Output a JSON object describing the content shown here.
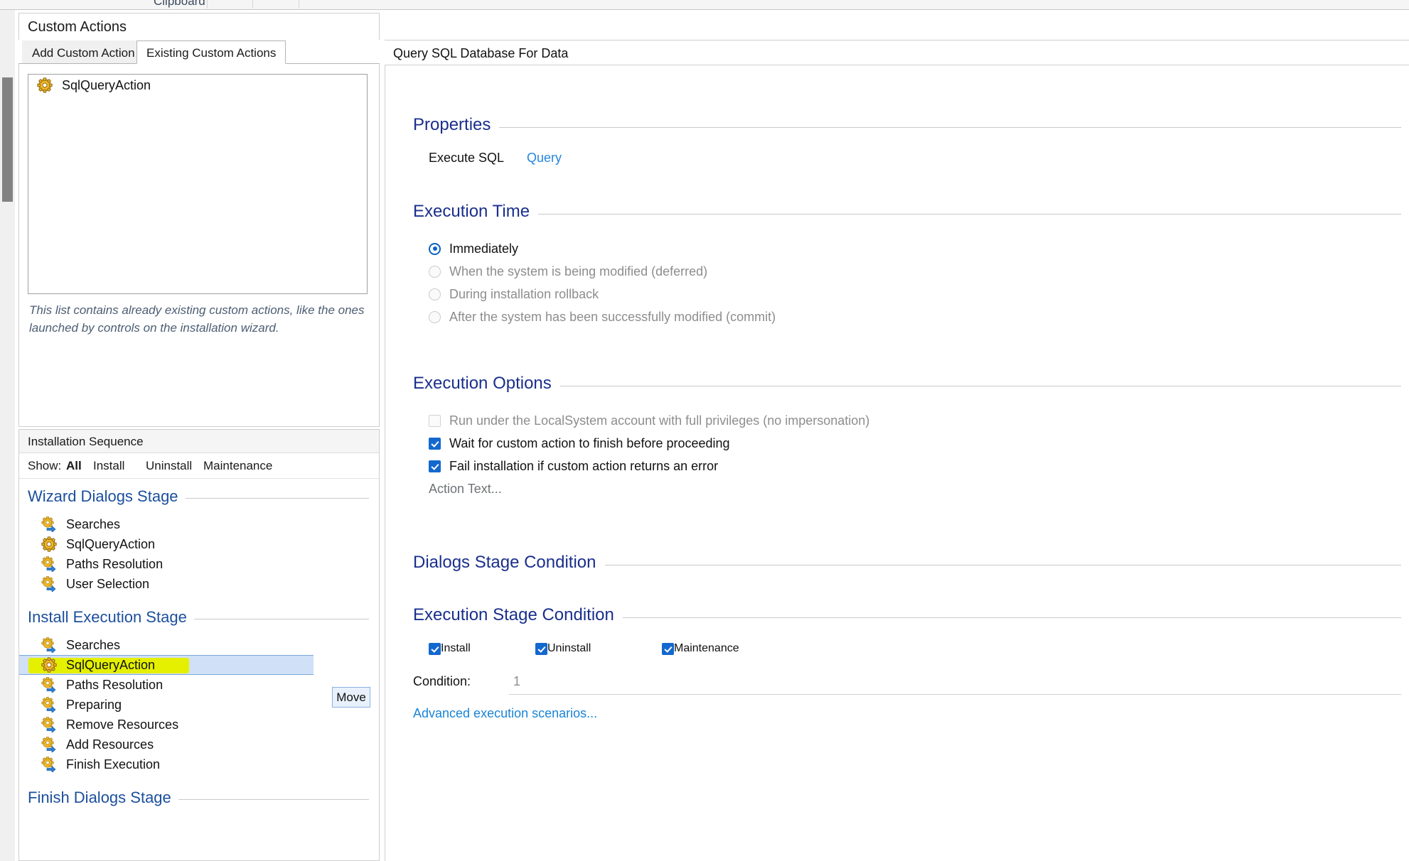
{
  "ribbon": {
    "group_label": "Clipboard"
  },
  "left": {
    "title": "Custom Actions",
    "tabs": [
      {
        "label": "Add Custom Action",
        "active": false
      },
      {
        "label": "Existing Custom Actions",
        "active": true
      }
    ],
    "existing_actions": [
      {
        "label": "SqlQueryAction",
        "icon": "gear-icon"
      }
    ],
    "help_text": "This list contains already existing custom actions, like the ones launched by controls on the installation wizard.",
    "sequence": {
      "header": "Installation Sequence",
      "show_label": "Show:",
      "filters": [
        {
          "label": "All",
          "active": true
        },
        {
          "label": "Install",
          "active": false
        },
        {
          "label": "Uninstall",
          "active": false
        },
        {
          "label": "Maintenance",
          "active": false
        }
      ],
      "move_button": "Move",
      "stages": [
        {
          "title": "Wizard Dialogs Stage",
          "items": [
            {
              "label": "Searches",
              "icon": "gear-arrow-icon",
              "selected": false
            },
            {
              "label": "SqlQueryAction",
              "icon": "gear-icon",
              "selected": false
            },
            {
              "label": "Paths Resolution",
              "icon": "gear-arrow-icon",
              "selected": false
            },
            {
              "label": "User Selection",
              "icon": "gear-arrow-icon",
              "selected": false
            }
          ]
        },
        {
          "title": "Install Execution Stage",
          "items": [
            {
              "label": "Searches",
              "icon": "gear-arrow-icon",
              "selected": false
            },
            {
              "label": "SqlQueryAction",
              "icon": "gear-icon",
              "selected": true,
              "highlighted": true
            },
            {
              "label": "Paths Resolution",
              "icon": "gear-arrow-icon",
              "selected": false
            },
            {
              "label": "Preparing",
              "icon": "gear-arrow-icon",
              "selected": false
            },
            {
              "label": "Remove Resources",
              "icon": "gear-arrow-icon",
              "selected": false
            },
            {
              "label": "Add Resources",
              "icon": "gear-arrow-icon",
              "selected": false
            },
            {
              "label": "Finish Execution",
              "icon": "gear-arrow-icon",
              "selected": false
            }
          ]
        },
        {
          "title": "Finish Dialogs Stage",
          "items": []
        }
      ]
    }
  },
  "right": {
    "header": "Query SQL Database For Data",
    "properties": {
      "section_title": "Properties",
      "rows": [
        {
          "label": "Execute SQL",
          "value": "Query"
        }
      ]
    },
    "execution_time": {
      "section_title": "Execution Time",
      "options": [
        {
          "label": "Immediately",
          "selected": true,
          "enabled": true
        },
        {
          "label": "When the system is being modified (deferred)",
          "selected": false,
          "enabled": false
        },
        {
          "label": "During installation rollback",
          "selected": false,
          "enabled": false
        },
        {
          "label": "After the system has been successfully modified (commit)",
          "selected": false,
          "enabled": false
        }
      ]
    },
    "execution_options": {
      "section_title": "Execution Options",
      "options": [
        {
          "label": "Run under the LocalSystem account with full privileges (no impersonation)",
          "checked": false,
          "enabled": false
        },
        {
          "label": "Wait for custom action to finish before proceeding",
          "checked": true,
          "enabled": true
        },
        {
          "label": "Fail installation if custom action returns an error",
          "checked": true,
          "enabled": true
        }
      ],
      "action_text": "Action Text..."
    },
    "dialogs_stage_condition": {
      "section_title": "Dialogs Stage Condition"
    },
    "execution_stage_condition": {
      "section_title": "Execution Stage Condition",
      "stages": [
        {
          "label": "Install",
          "checked": true
        },
        {
          "label": "Uninstall",
          "checked": true
        },
        {
          "label": "Maintenance",
          "checked": true
        }
      ],
      "condition_label": "Condition:",
      "condition_value": "1",
      "advanced_link": "Advanced execution scenarios..."
    }
  }
}
